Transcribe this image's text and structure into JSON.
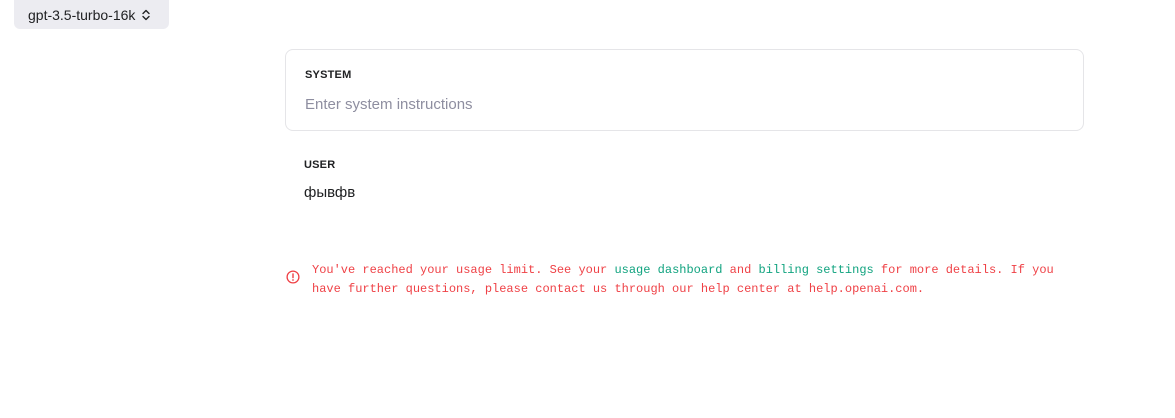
{
  "model_selector": {
    "value": "gpt-3.5-turbo-16k",
    "icon": "chevron-up-down-icon"
  },
  "system": {
    "label": "SYSTEM",
    "placeholder": "Enter system instructions",
    "value": ""
  },
  "user": {
    "label": "USER",
    "message": "фывфв"
  },
  "error": {
    "icon": "alert-circle-icon",
    "color": "#ef4146",
    "link_color": "#10a37f",
    "text_before": "You've reached your usage limit. See your ",
    "link_usage_dashboard": "usage dashboard",
    "text_and": " and ",
    "link_billing_settings": "billing settings",
    "text_after": " for more details. If you have further questions, please contact us through our help center at help.openai.com."
  }
}
